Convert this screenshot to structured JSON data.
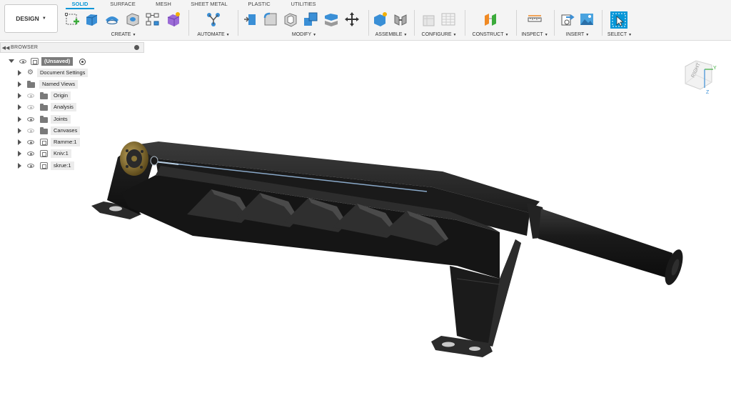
{
  "toolbar": {
    "workspace": "DESIGN",
    "tabs": [
      "SOLID",
      "SURFACE",
      "MESH",
      "SHEET METAL",
      "PLASTIC",
      "UTILITIES"
    ],
    "active_tab": "SOLID",
    "groups": [
      "CREATE",
      "AUTOMATE",
      "MODIFY",
      "ASSEMBLE",
      "CONFIGURE",
      "CONSTRUCT",
      "INSPECT",
      "INSERT",
      "SELECT"
    ]
  },
  "browser": {
    "title": "BROWSER",
    "items": [
      {
        "label": "(Unsaved)"
      },
      {
        "label": "Document Settings"
      },
      {
        "label": "Named Views"
      },
      {
        "label": "Origin"
      },
      {
        "label": "Analysis"
      },
      {
        "label": "Joints"
      },
      {
        "label": "Canvases"
      },
      {
        "label": "Ramme:1"
      },
      {
        "label": "Kniv:1"
      },
      {
        "label": "skrue:1"
      }
    ]
  },
  "viewcube": {
    "face": "RIGHT",
    "axes": [
      "Y",
      "Z"
    ]
  },
  "colors": {
    "accent": "#0696d7",
    "model": "#1e1e1e"
  }
}
